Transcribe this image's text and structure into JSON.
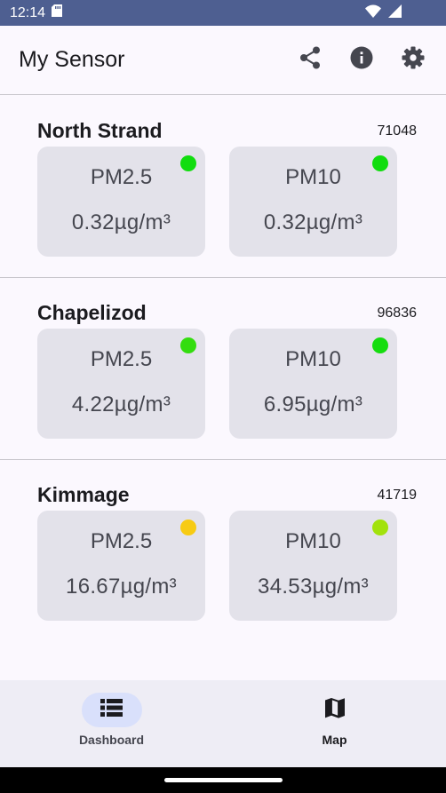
{
  "status_bar": {
    "time": "12:14"
  },
  "app_bar": {
    "title": "My Sensor"
  },
  "sensors": [
    {
      "name": "North Strand",
      "id": "71048",
      "readings": [
        {
          "type": "PM2.5",
          "value": "0.32µg/m³",
          "status_color": "#11dd0f"
        },
        {
          "type": "PM10",
          "value": "0.32µg/m³",
          "status_color": "#11dd0f"
        }
      ]
    },
    {
      "name": "Chapelizod",
      "id": "96836",
      "readings": [
        {
          "type": "PM2.5",
          "value": "4.22µg/m³",
          "status_color": "#34dd0f"
        },
        {
          "type": "PM10",
          "value": "6.95µg/m³",
          "status_color": "#15dd0f"
        }
      ]
    },
    {
      "name": "Kimmage",
      "id": "41719",
      "readings": [
        {
          "type": "PM2.5",
          "value": "16.67µg/m³",
          "status_color": "#f7cb13"
        },
        {
          "type": "PM10",
          "value": "34.53µg/m³",
          "status_color": "#a2e20c"
        }
      ]
    }
  ],
  "bottom_nav": {
    "items": [
      {
        "label": "Dashboard",
        "icon": "list-icon",
        "active": true
      },
      {
        "label": "Map",
        "icon": "map-icon",
        "active": false
      }
    ]
  },
  "colors": {
    "status_bar": "#4e5f91",
    "background": "#fbf8fe",
    "card": "#e3e2ea",
    "nav_bar": "#eeedf5",
    "nav_active_pill": "#d9e0fb"
  }
}
